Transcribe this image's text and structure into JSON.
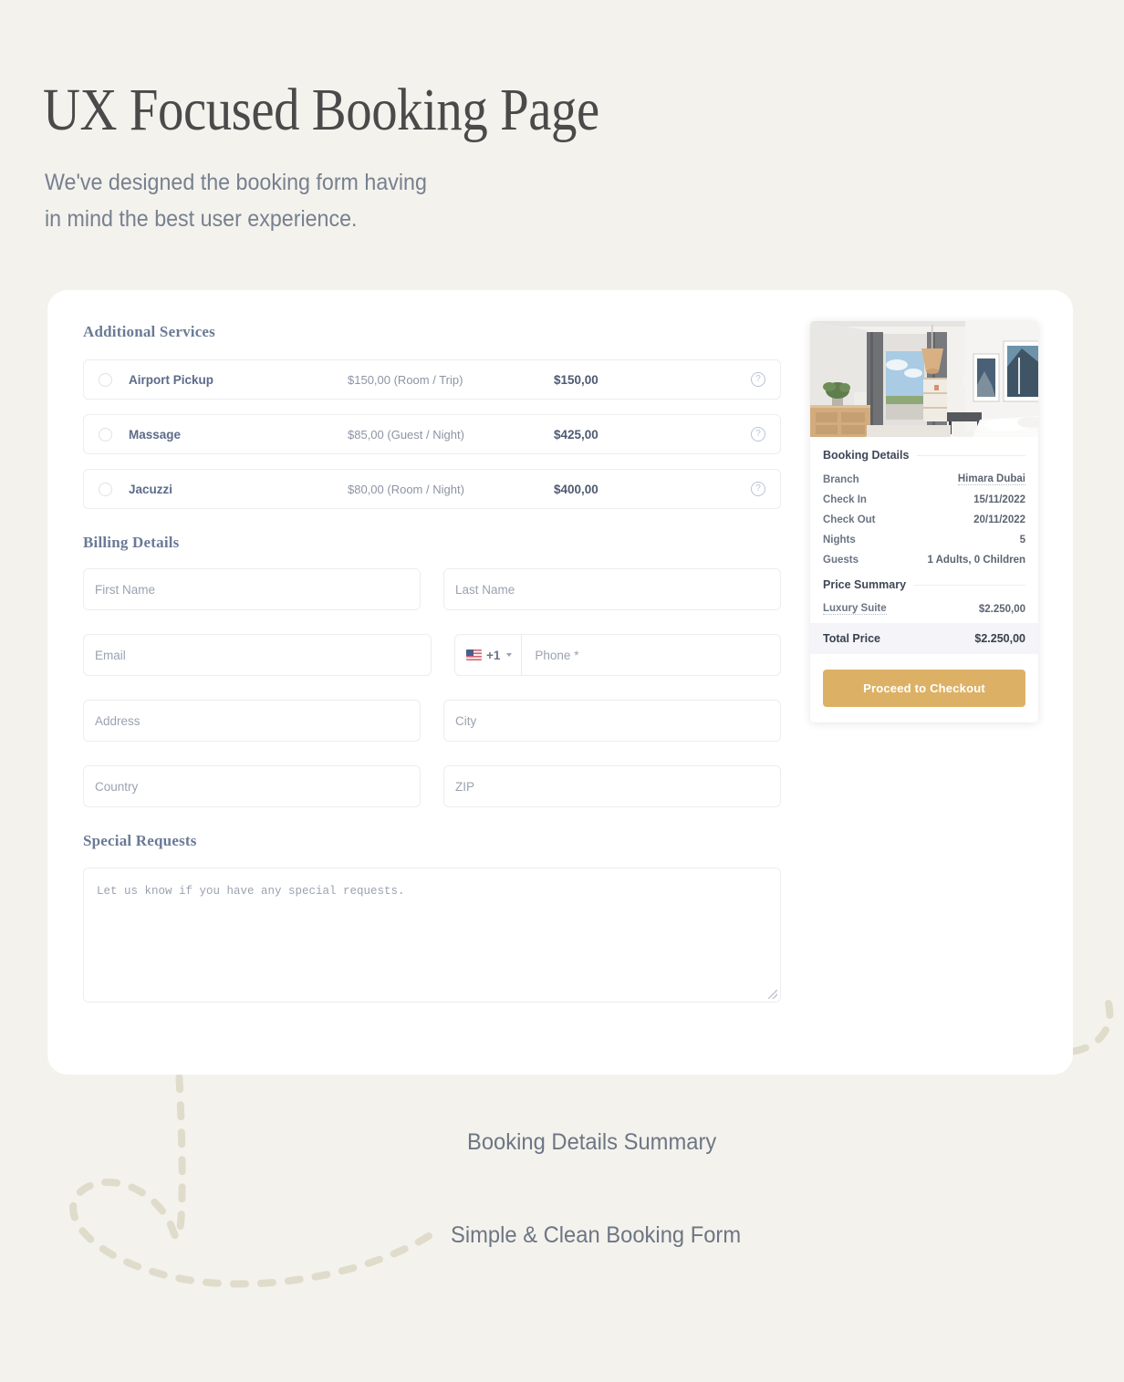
{
  "hero": {
    "title": "UX Focused Booking Page",
    "subtitle_line1": "We've designed the booking form having",
    "subtitle_line2": "in mind the best user experience."
  },
  "annotations": {
    "summary": "Booking Details Summary",
    "form": "Simple & Clean Booking Form"
  },
  "services": {
    "heading": "Additional Services",
    "items": [
      {
        "name": "Airport Pickup",
        "rate": "$150,00 (Room / Trip)",
        "total": "$150,00",
        "help": "?"
      },
      {
        "name": "Massage",
        "rate": "$85,00 (Guest / Night)",
        "total": "$425,00",
        "help": "?"
      },
      {
        "name": "Jacuzzi",
        "rate": "$80,00 (Room / Night)",
        "total": "$400,00",
        "help": "?"
      }
    ]
  },
  "billing": {
    "heading": "Billing Details",
    "first_name_placeholder": "First Name",
    "last_name_placeholder": "Last Name",
    "email_placeholder": "Email",
    "phone_placeholder": "Phone *",
    "phone_dial_code": "+1",
    "address_placeholder": "Address",
    "city_placeholder": "City",
    "country_placeholder": "Country",
    "zip_placeholder": "ZIP"
  },
  "requests": {
    "heading": "Special Requests",
    "placeholder": "Let us know if you have any special requests."
  },
  "summary": {
    "booking_details_heading": "Booking Details",
    "rows": [
      {
        "label": "Branch",
        "value": "Himara Dubai",
        "dotted": true
      },
      {
        "label": "Check In",
        "value": "15/11/2022",
        "dotted": false
      },
      {
        "label": "Check Out",
        "value": "20/11/2022",
        "dotted": false
      },
      {
        "label": "Nights",
        "value": "5",
        "dotted": false
      },
      {
        "label": "Guests",
        "value": "1 Adults, 0 Children",
        "dotted": false
      }
    ],
    "price_summary_heading": "Price Summary",
    "price_rows": [
      {
        "label": "Luxury Suite",
        "value": "$2.250,00"
      }
    ],
    "total_label": "Total Price",
    "total_value": "$2.250,00",
    "checkout_label": "Proceed to Checkout"
  },
  "colors": {
    "page_background": "#f4f2ed",
    "card_background": "#ffffff",
    "accent_gold": "#ddb165",
    "heading_blue": "#6a7a96",
    "dashed_line": "#e0dccb",
    "total_row_background": "#f4f4f9"
  }
}
